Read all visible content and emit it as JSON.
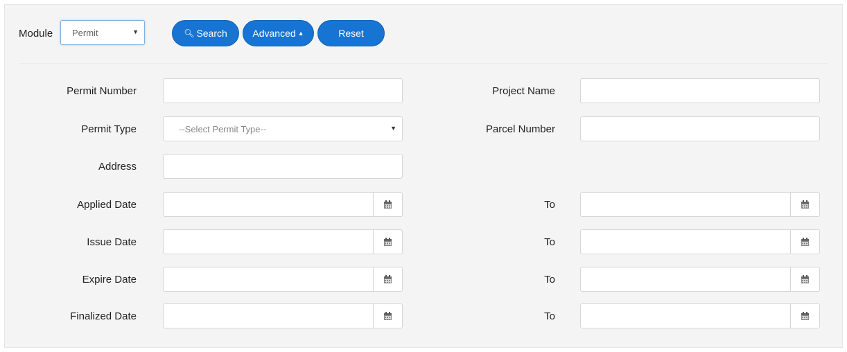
{
  "topbar": {
    "module_label": "Module",
    "module_value": "Permit",
    "search_label": "Search",
    "advanced_label": "Advanced",
    "reset_label": "Reset"
  },
  "form": {
    "permit_number_label": "Permit Number",
    "project_name_label": "Project Name",
    "permit_type_label": "Permit Type",
    "permit_type_placeholder": "--Select Permit Type--",
    "parcel_number_label": "Parcel Number",
    "address_label": "Address",
    "applied_date_label": "Applied Date",
    "issue_date_label": "Issue Date",
    "expire_date_label": "Expire Date",
    "finalized_date_label": "Finalized Date",
    "to_label": "To"
  },
  "icons": {
    "search": "search-icon",
    "caret_up": "caret-up-icon",
    "caret_down": "caret-down-icon",
    "calendar": "calendar-icon"
  },
  "colors": {
    "accent": "#1774d3",
    "panel_bg": "#f4f4f4"
  }
}
